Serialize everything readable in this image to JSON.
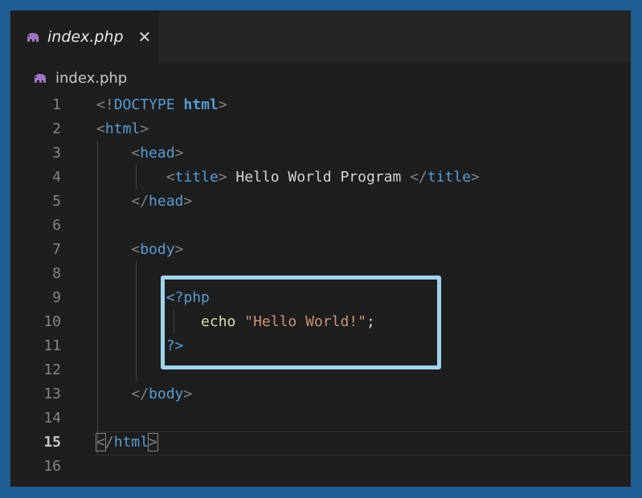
{
  "tab": {
    "icon": "php-elephant-icon",
    "filename": "index.php",
    "close_glyph": "✕"
  },
  "breadcrumb": {
    "icon": "php-elephant-icon",
    "filename": "index.php"
  },
  "editor": {
    "active_line": 15,
    "lines": [
      {
        "n": "1",
        "tokens": [
          [
            "p",
            "<!"
          ],
          [
            "t",
            "DOCTYPE "
          ],
          [
            "tb",
            "html"
          ],
          [
            "p",
            ">"
          ]
        ]
      },
      {
        "n": "2",
        "tokens": [
          [
            "p",
            "<"
          ],
          [
            "t",
            "html"
          ],
          [
            "p",
            ">"
          ]
        ]
      },
      {
        "n": "3",
        "tokens": [
          [
            "w",
            "    "
          ],
          [
            "p",
            "<"
          ],
          [
            "t",
            "head"
          ],
          [
            "p",
            ">"
          ]
        ]
      },
      {
        "n": "4",
        "tokens": [
          [
            "w",
            "        "
          ],
          [
            "p",
            "<"
          ],
          [
            "t",
            "title"
          ],
          [
            "p",
            ">"
          ],
          [
            "w",
            " Hello World Program "
          ],
          [
            "p",
            "</"
          ],
          [
            "t",
            "title"
          ],
          [
            "p",
            ">"
          ]
        ]
      },
      {
        "n": "5",
        "tokens": [
          [
            "w",
            "    "
          ],
          [
            "p",
            "</"
          ],
          [
            "t",
            "head"
          ],
          [
            "p",
            ">"
          ]
        ]
      },
      {
        "n": "6",
        "tokens": []
      },
      {
        "n": "7",
        "tokens": [
          [
            "w",
            "    "
          ],
          [
            "p",
            "<"
          ],
          [
            "t",
            "body"
          ],
          [
            "p",
            ">"
          ]
        ]
      },
      {
        "n": "8",
        "tokens": []
      },
      {
        "n": "9",
        "tokens": [
          [
            "w",
            "        "
          ],
          [
            "t",
            "<?php"
          ]
        ]
      },
      {
        "n": "10",
        "tokens": [
          [
            "w",
            "            "
          ],
          [
            "kw",
            "echo"
          ],
          [
            "w",
            " "
          ],
          [
            "str",
            "\"Hello World!\""
          ],
          [
            "w",
            ";"
          ]
        ]
      },
      {
        "n": "11",
        "tokens": [
          [
            "w",
            "        "
          ],
          [
            "t",
            "?>"
          ]
        ]
      },
      {
        "n": "12",
        "tokens": []
      },
      {
        "n": "13",
        "tokens": [
          [
            "w",
            "    "
          ],
          [
            "p",
            "</"
          ],
          [
            "t",
            "body"
          ],
          [
            "p",
            ">"
          ]
        ]
      },
      {
        "n": "14",
        "tokens": []
      },
      {
        "n": "15",
        "tokens": [
          [
            "bracket",
            "<"
          ],
          [
            "p",
            "/"
          ],
          [
            "t",
            "html"
          ],
          [
            "bracket",
            ">"
          ]
        ]
      },
      {
        "n": "16",
        "tokens": []
      }
    ]
  },
  "colors": {
    "frame": "#1f5d93",
    "editor_bg": "#1e1e1e",
    "highlight_border": "#9fd4ee",
    "tag": "#569cd6",
    "string": "#ce9178",
    "keyword": "#dcdcaa"
  }
}
